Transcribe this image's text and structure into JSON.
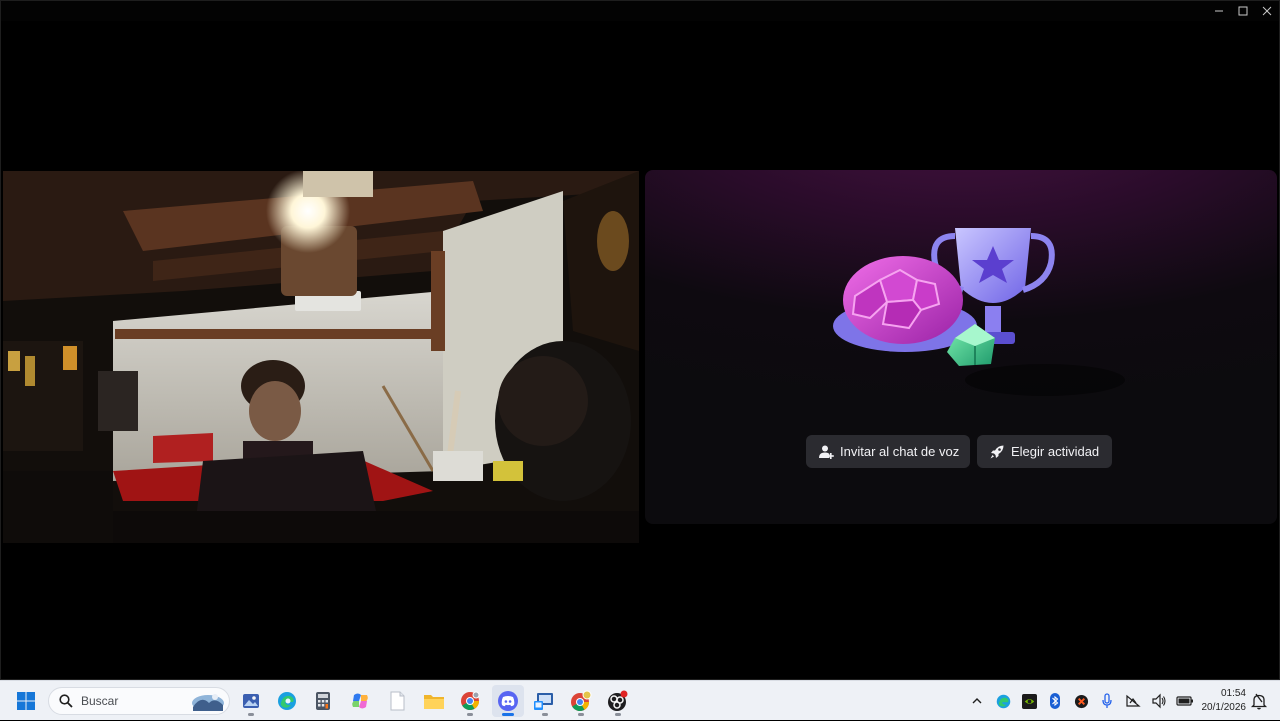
{
  "window": {
    "controls": {
      "minimize_icon": "minimize-icon",
      "maximize_icon": "maximize-icon",
      "close_icon": "close-icon"
    }
  },
  "activity_panel": {
    "invite_button_label": "Invitar al chat de voz",
    "invite_icon": "add-user-icon",
    "activity_button_label": "Elegir actividad",
    "activity_icon": "rocket-icon",
    "illustration_icon": "trophy-shell-dice-illustration",
    "background_color": "#2a0c2a",
    "button_color": "#2b2b30"
  },
  "taskbar": {
    "search_placeholder": "Buscar",
    "apps": [
      "start-icon",
      "image-viewer-icon",
      "edge-icon",
      "calculator-icon",
      "copilot-icon",
      "notepad-icon",
      "file-explorer-icon",
      "chrome-icon",
      "discord-icon",
      "network-tool-icon",
      "chrome-profile-icon",
      "obs-icon"
    ],
    "tray_icons": [
      "chevron-up-icon",
      "edge-tray-icon",
      "nvidia-icon",
      "bluetooth-icon",
      "steelseries-icon",
      "microphone-icon",
      "network-icon",
      "volume-icon",
      "battery-icon"
    ],
    "time": "01:54",
    "date": "20/1/2026",
    "accent_color": "#1a73e8"
  }
}
